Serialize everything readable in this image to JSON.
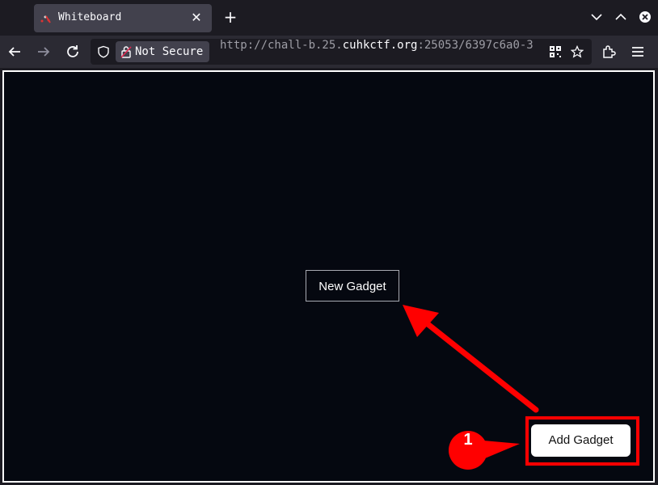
{
  "browser": {
    "tab_title": "Whiteboard",
    "newtab_symbol": "+",
    "close_symbol": "✕",
    "security_label": "Not Secure",
    "url_scheme": "http://chall-b.25.",
    "url_host": "cuhkctf.org",
    "url_rest": ":25053/6397c6a0-3"
  },
  "page": {
    "gadget_label": "New Gadget",
    "add_button_label": "Add Gadget"
  },
  "annotation": {
    "step_number": "1",
    "color": "#ff0000"
  },
  "colors": {
    "canvas_bg": "#050810",
    "chrome_bg": "#1c1b22",
    "toolbar_bg": "#2b2a33",
    "tab_bg": "#42414d"
  },
  "icons": [
    "tab-favicon-icon",
    "close-tab-icon",
    "new-tab-icon",
    "chevron-down-icon",
    "chevron-up-icon",
    "close-window-icon",
    "back-arrow-icon",
    "forward-arrow-icon",
    "reload-icon",
    "shield-icon",
    "lock-icon",
    "qr-code-icon",
    "bookmark-star-icon",
    "extensions-icon",
    "menu-icon"
  ]
}
